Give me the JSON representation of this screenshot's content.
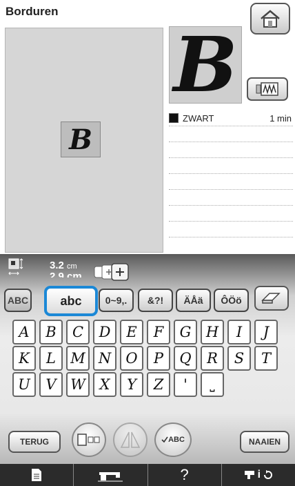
{
  "header": {
    "title": "Borduren"
  },
  "preview": {
    "letter": "B"
  },
  "thumbnail": {
    "letter": "B"
  },
  "colors": [
    {
      "name": "ZWART",
      "time": "1 min",
      "swatch": "#111111"
    }
  ],
  "size": {
    "width": "3.2",
    "width_unit": "cm",
    "height": "2.9 cm"
  },
  "tabs": {
    "upper": "ABC",
    "lower": "abc",
    "numbers": "0~9,.",
    "symbols": "&?!",
    "accents1": "ÄÅä",
    "accents2": "ÔÖö"
  },
  "keys": [
    [
      "A",
      "B",
      "C",
      "D",
      "E",
      "F",
      "G",
      "H",
      "I",
      "J"
    ],
    [
      "K",
      "L",
      "M",
      "N",
      "O",
      "P",
      "Q",
      "R",
      "S",
      "T"
    ],
    [
      "U",
      "V",
      "W",
      "X",
      "Y",
      "Z",
      "'",
      "␣"
    ]
  ],
  "buttons": {
    "back": "TERUG",
    "abc_round": "ABC",
    "sew": "NAAIEN"
  },
  "bottom_bar": {
    "help": "?",
    "info": "i"
  },
  "colors_theme": {
    "accent": "#1b88d6",
    "panel_dark": "#595959",
    "bottom_bar": "#2b2b2b"
  }
}
